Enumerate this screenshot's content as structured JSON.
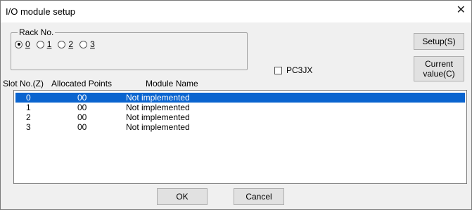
{
  "window": {
    "title": "I/O module setup",
    "close_glyph": "✕"
  },
  "rack": {
    "label": "Rack No.",
    "options": [
      "0",
      "1",
      "2",
      "3"
    ],
    "selected": "0"
  },
  "buttons": {
    "setup_label": "Setup(S)",
    "current_line1": "Current",
    "current_line2": "value(C)",
    "ok_label": "OK",
    "cancel_label": "Cancel"
  },
  "checkbox": {
    "label": "PC3JX",
    "checked": false
  },
  "columns": {
    "slot": "Slot No.(Z)",
    "points": "Allocated Points",
    "name": "Module Name"
  },
  "rows": [
    {
      "slot": "0",
      "points": "00",
      "name": "Not implemented",
      "selected": true
    },
    {
      "slot": "1",
      "points": "00",
      "name": "Not implemented",
      "selected": false
    },
    {
      "slot": "2",
      "points": "00",
      "name": "Not implemented",
      "selected": false
    },
    {
      "slot": "3",
      "points": "00",
      "name": "Not implemented",
      "selected": false
    }
  ],
  "colors": {
    "selection": "#0a64cf",
    "window_bg": "#f0f0f0",
    "button_bg": "#e1e1e1"
  },
  "icons": {
    "close": "close-icon"
  }
}
